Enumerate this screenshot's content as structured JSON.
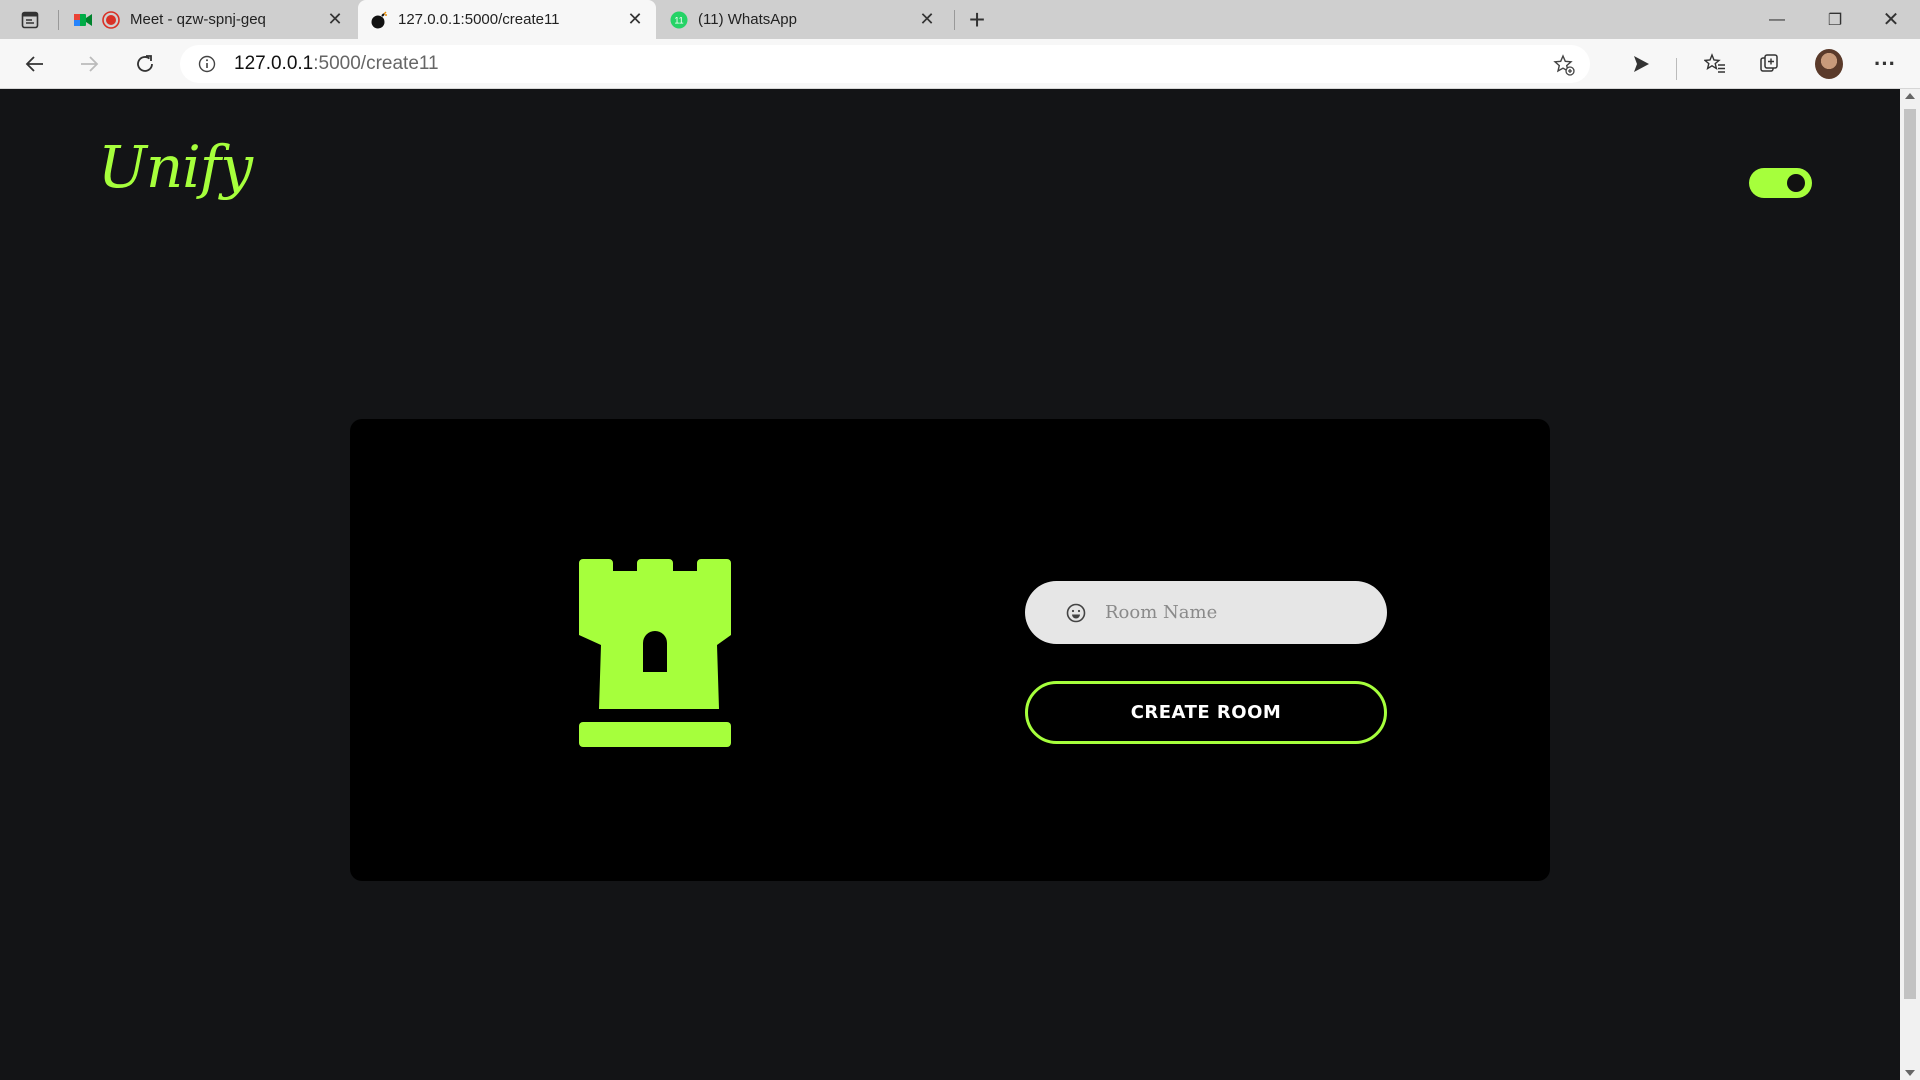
{
  "browser": {
    "tabs": [
      {
        "title": "Meet - qzw-spnj-geq",
        "favicon": "google-meet-icon",
        "active": false
      },
      {
        "title": "127.0.0.1:5000/create11",
        "favicon": "bomb-icon",
        "active": true
      },
      {
        "title": "(11) WhatsApp",
        "favicon": "whatsapp-icon",
        "active": false
      }
    ],
    "url_host": "127.0.0.1",
    "url_path": ":5000/create11",
    "close_glyph": "✕",
    "new_tab_glyph": "+",
    "minimize_glyph": "—",
    "restore_glyph": "❐",
    "window_close_glyph": "✕",
    "more_glyph": "···"
  },
  "page": {
    "logo_text": "Unify",
    "theme_toggle_on": true,
    "room_name_placeholder": "Room Name",
    "create_button_label": "CREATE ROOM",
    "accent_color": "#a6ff3c",
    "background_color": "#131416"
  }
}
